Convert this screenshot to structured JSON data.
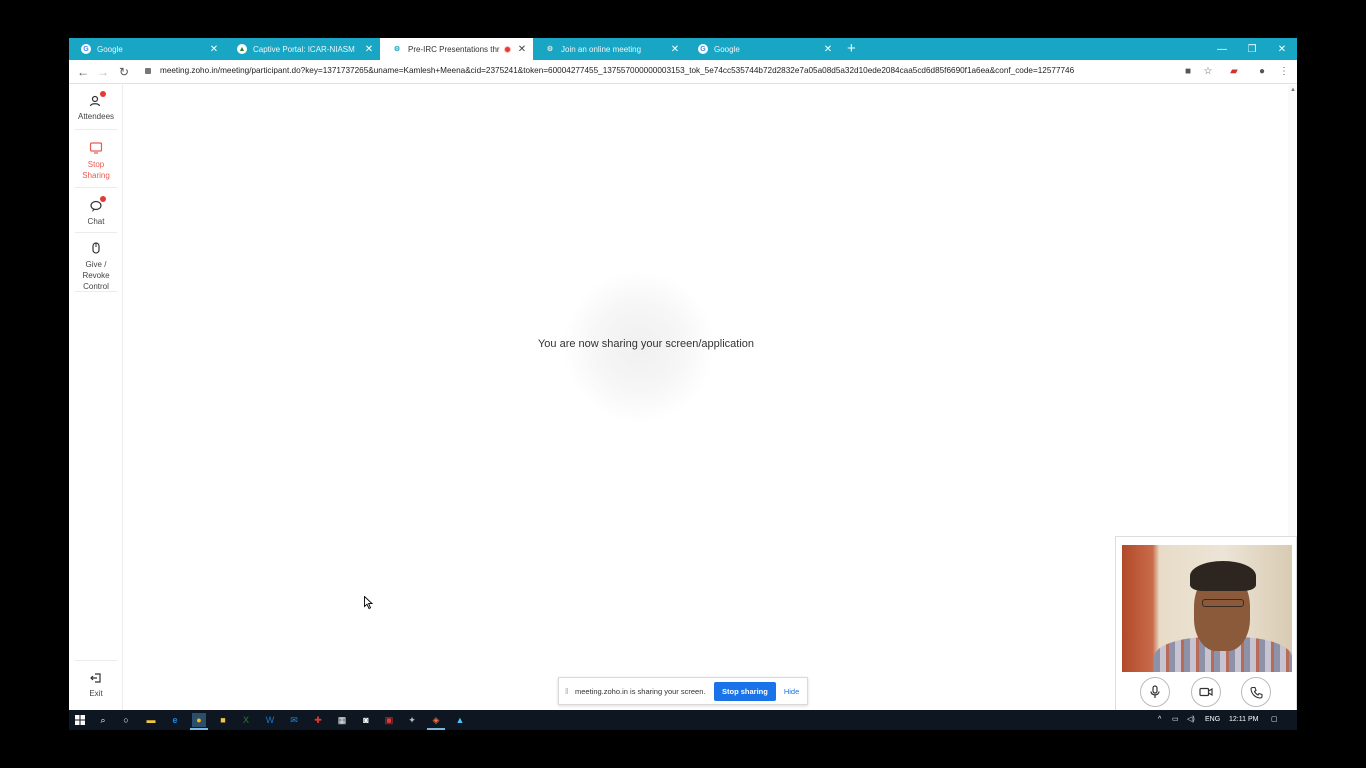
{
  "browser": {
    "tabs": [
      {
        "label": "Google",
        "favicon": "google-icon",
        "active": false
      },
      {
        "label": "Captive Portal: ICAR-NIASM",
        "favicon": "portal-icon",
        "active": false
      },
      {
        "label": "Pre-IRC Presentations throug",
        "favicon": "zoho-icon",
        "active": true,
        "recording": true
      },
      {
        "label": "Join an online meeting",
        "favicon": "zoho-icon",
        "active": false
      },
      {
        "label": "Google",
        "favicon": "google-icon",
        "active": false
      }
    ],
    "new_tab_label": "+",
    "url": "meeting.zoho.in/meeting/participant.do?key=1371737265&uname=Kamlesh+Meena&cid=2375241&token=60004277455_137557000000003153_tok_5e74cc535744b72d2832e7a05a08d5a32d10ede2084caa5cd6d85f6690f1a6ea&conf_code=12577746"
  },
  "rail": {
    "attendees": "Attendees",
    "stop_sharing": "Stop Sharing",
    "chat": "Chat",
    "give_revoke": "Give / Revoke Control",
    "exit": "Exit"
  },
  "main": {
    "sharing_message": "You are now sharing your screen/application"
  },
  "sharebar": {
    "message": "meeting.zoho.in is sharing your screen.",
    "stop_label": "Stop sharing",
    "hide_label": "Hide"
  },
  "taskbar": {
    "language": "ENG",
    "time": "12:11 PM"
  },
  "colors": {
    "tabstrip": "#19a6c4",
    "accent_blue": "#1a73e8",
    "stop_red": "#e85a4f"
  }
}
